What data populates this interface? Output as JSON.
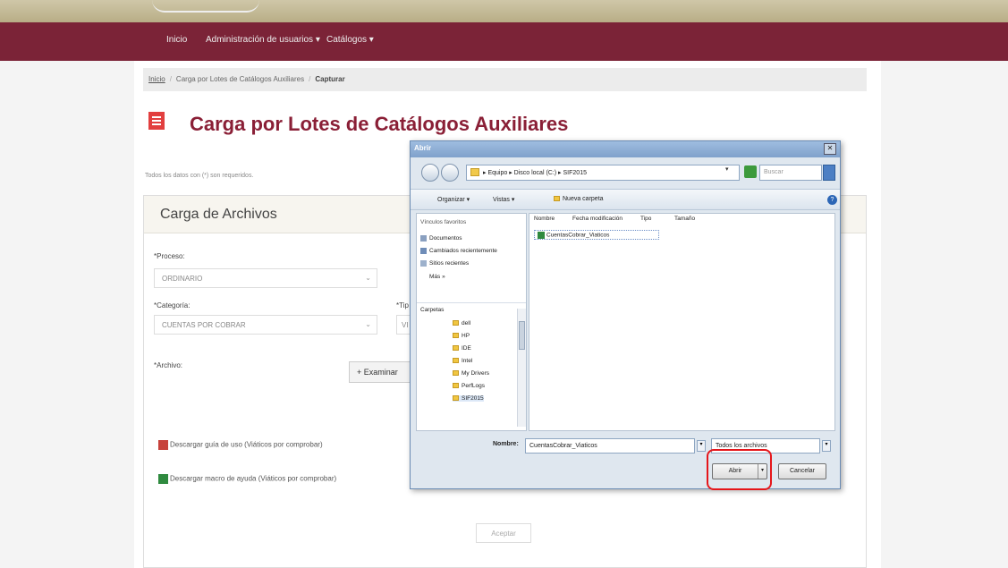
{
  "nav": {
    "items": [
      "Inicio",
      "Administración de usuarios ▾",
      "Catálogos ▾"
    ]
  },
  "breadcrumb": {
    "home": "Inicio",
    "section": "Carga por Lotes de Catálogos Auxiliares",
    "current": "Capturar"
  },
  "page": {
    "title": "Carga por Lotes de Catálogos Auxiliares",
    "required_note": "Todos los datos con (*) son requeridos."
  },
  "panel": {
    "title": "Carga de Archivos",
    "proceso_label": "*Proceso:",
    "proceso_value": "ORDINARIO",
    "categoria_label": "*Categoría:",
    "categoria_value": "CUENTAS POR COBRAR",
    "tipo_label": "*Tip",
    "tipo_value": "VI",
    "archivo_label": "*Archivo:",
    "browse_label": "+ Examinar",
    "download_guide": "Descargar guía de uso (Viáticos por comprobar)",
    "download_macro": "Descargar macro de ayuda (Viáticos por comprobar)",
    "accept_label": "Aceptar"
  },
  "dialog": {
    "title": "Abrir",
    "address": "▸ Equipo ▸ Disco local (C:) ▸ SIF2015",
    "search_placeholder": "Buscar",
    "toolbar": {
      "organize": "Organizar ▾",
      "views": "Vistas ▾",
      "new_folder": "Nueva carpeta"
    },
    "favorites_header": "Vínculos favoritos",
    "favorites": [
      "Documentos",
      "Cambiados recientemente",
      "Sitios recientes",
      "Más »"
    ],
    "folders_header": "Carpetas",
    "folders": [
      "dell",
      "HP",
      "IDE",
      "Intel",
      "My Drivers",
      "PerfLogs",
      "SIF2015"
    ],
    "columns": [
      "Nombre",
      "Fecha modificación",
      "Tipo",
      "Tamaño"
    ],
    "files": [
      "CuentasCobrar_Viaticos"
    ],
    "filename_label": "Nombre:",
    "filename_value": "CuentasCobrar_Viaticos",
    "filetype_value": "Todos los archivos",
    "open_label": "Abrir",
    "cancel_label": "Cancelar"
  },
  "colors": {
    "navbar": "#7b2337",
    "title": "#8a1f36",
    "highlight": "#e5161b"
  }
}
